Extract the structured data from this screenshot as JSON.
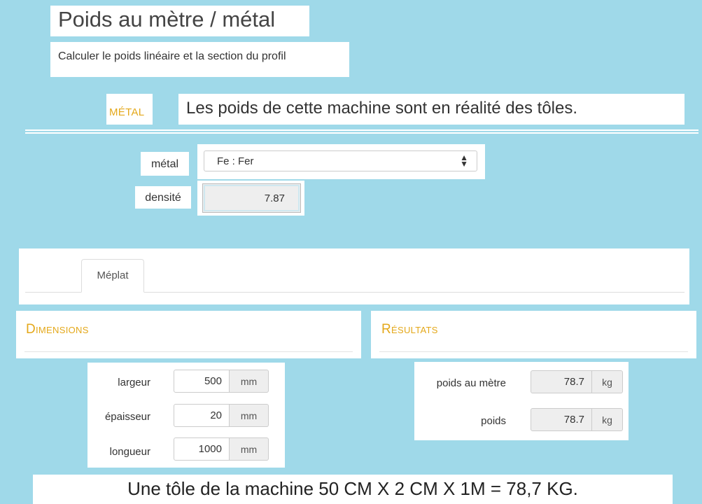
{
  "header": {
    "title": "Poids au mètre / métal",
    "subtitle": "Calculer le poids linéaire et la section du profil"
  },
  "metal_section": {
    "heading": "MÉTAL",
    "note": "Les poids de cette machine sont en réalité des tôles.",
    "metal_label": "métal",
    "metal_value": "Fe : Fer",
    "density_label": "densité",
    "density_value": "7.87"
  },
  "tabs": [
    {
      "label": "Méplat",
      "active": true
    }
  ],
  "dimensions": {
    "heading": "Dimensions",
    "rows": [
      {
        "label": "largeur",
        "value": "500",
        "unit": "mm"
      },
      {
        "label": "épaisseur",
        "value": "20",
        "unit": "mm"
      },
      {
        "label": "longueur",
        "value": "1000",
        "unit": "mm"
      }
    ]
  },
  "results": {
    "heading": "Résultats",
    "rows": [
      {
        "label": "poids au mètre",
        "value": "78.7",
        "unit": "kg"
      },
      {
        "label": "poids",
        "value": "78.7",
        "unit": "kg"
      }
    ]
  },
  "footer_note": "Une tôle de la machine 50 CM X 2 CM X 1M = 78,7 KG.",
  "colors": {
    "background": "#9fd9e9",
    "accent": "#e4a81a"
  }
}
